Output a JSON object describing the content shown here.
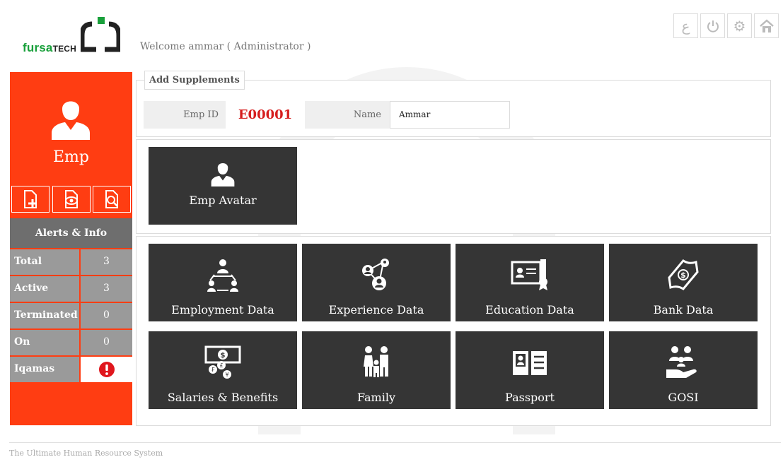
{
  "header": {
    "logo_brand": "fursa",
    "logo_brand_suffix": "TECH",
    "welcome": "Welcome ammar ( Administrator )",
    "icons": [
      {
        "name": "arabic-language-icon",
        "glyph": "ع"
      },
      {
        "name": "power-icon",
        "glyph": "⏻"
      },
      {
        "name": "gear-icon",
        "glyph": "⚙"
      },
      {
        "name": "home-icon",
        "glyph": "⌂"
      }
    ]
  },
  "sidebar": {
    "title": "Emp",
    "actions": [
      "add-document-icon",
      "view-document-icon",
      "search-document-icon"
    ],
    "alerts_title": "Alerts & Info",
    "rows": [
      {
        "label": "Total",
        "value": "3"
      },
      {
        "label": "Active",
        "value": "3"
      },
      {
        "label": "Terminated",
        "value": "0"
      },
      {
        "label": "On Vacation",
        "value": "0"
      },
      {
        "label": "Iqamas",
        "value": ""
      }
    ],
    "accent_color": "#ff3d12"
  },
  "form": {
    "legend": "Add Supplements",
    "emp_id_label": "Emp ID",
    "emp_id_value": "E00001",
    "name_label": "Name",
    "name_value": "Ammar"
  },
  "avatar_tile": {
    "label": "Emp Avatar",
    "icon": "person-icon"
  },
  "tiles": [
    {
      "label": "Employment Data",
      "icon": "org-chart-icon"
    },
    {
      "label": "Experience Data",
      "icon": "network-people-icon"
    },
    {
      "label": "Education Data",
      "icon": "certificate-icon"
    },
    {
      "label": "Bank Data",
      "icon": "money-bill-icon"
    },
    {
      "label": "Salaries & Benefits",
      "icon": "currency-icon"
    },
    {
      "label": "Family",
      "icon": "family-icon"
    },
    {
      "label": "Passport",
      "icon": "passport-icon"
    },
    {
      "label": "GOSI",
      "icon": "insurance-hand-icon"
    }
  ],
  "footer": {
    "text": "The Ultimate Human Resource System"
  }
}
